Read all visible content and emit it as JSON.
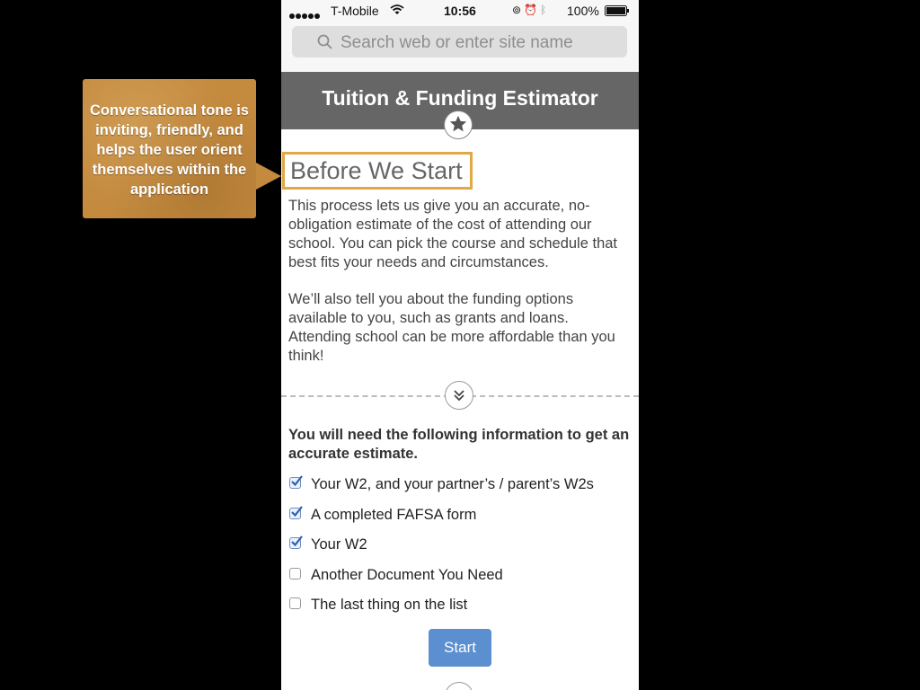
{
  "callout": {
    "text": "Conversational tone is inviting, friendly, and helps the user orient themselves within the application",
    "color": "#c48a3e"
  },
  "status_bar": {
    "carrier": "T-Mobile",
    "time": "10:56",
    "battery": "100%",
    "icons": [
      "signal-dots-icon",
      "wifi-icon",
      "rotation-lock-icon",
      "alarm-icon",
      "bluetooth-icon",
      "battery-icon"
    ]
  },
  "browser": {
    "search_placeholder": "Search web or enter site name"
  },
  "header": {
    "title": "Tuition & Funding Estimator",
    "color": "#666666"
  },
  "main": {
    "section_title": "Before We Start",
    "highlight_color": "#e0a847",
    "paragraph_1": "This process lets us give you an accurate, no-obligation estimate of the cost of attending our school. You can pick the course and schedule that best fits your needs and circumstances.",
    "paragraph_2": "We’ll also tell you about the funding options available to you, such as grants and loans. Attending school can be more affordable than you think!",
    "need_text": "You will need the following information to get an accurate estimate.",
    "checklist": [
      {
        "label": "Your W2, and your partner’s / parent’s W2s",
        "checked": true
      },
      {
        "label": "A completed FAFSA form",
        "checked": true
      },
      {
        "label": "Your W2",
        "checked": true
      },
      {
        "label": "Another Document You Need",
        "checked": false
      },
      {
        "label": "The last thing on the list",
        "checked": false
      }
    ],
    "start_label": "Start",
    "button_color": "#5b8fd0"
  }
}
